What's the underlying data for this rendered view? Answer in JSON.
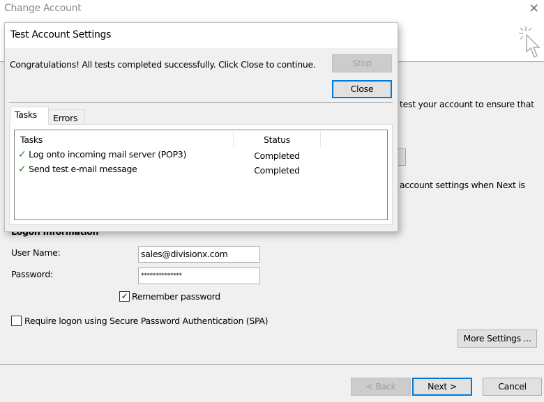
{
  "window": {
    "title": "Change Account",
    "close_icon": "close-icon",
    "wizard_icon": "cursor-click-icon"
  },
  "background": {
    "text_line1": "test your account to ensure that",
    "text_line2": "account settings when Next is",
    "section_title": "Logon Information",
    "user_name_label": "User Name:",
    "user_name_value": "sales@divisionx.com",
    "password_label": "Password:",
    "password_value": "**************",
    "remember_label": "Remember password",
    "remember_checked": true,
    "spa_label": "Require logon using Secure Password Authentication (SPA)",
    "spa_checked": false,
    "more_settings": "More Settings ...",
    "back": "< Back",
    "next": "Next >",
    "cancel": "Cancel"
  },
  "dialog": {
    "title": "Test Account Settings",
    "message": "Congratulations! All tests completed successfully. Click Close to continue.",
    "stop": "Stop",
    "close": "Close",
    "tabs": [
      {
        "label": "Tasks",
        "active": true
      },
      {
        "label": "Errors",
        "active": false
      }
    ],
    "columns": [
      "Tasks",
      "Status"
    ],
    "rows": [
      {
        "task": "Log onto incoming mail server (POP3)",
        "status": "Completed",
        "icon": "checkmark-icon"
      },
      {
        "task": "Send test e-mail message",
        "status": "Completed",
        "icon": "checkmark-icon"
      }
    ]
  }
}
